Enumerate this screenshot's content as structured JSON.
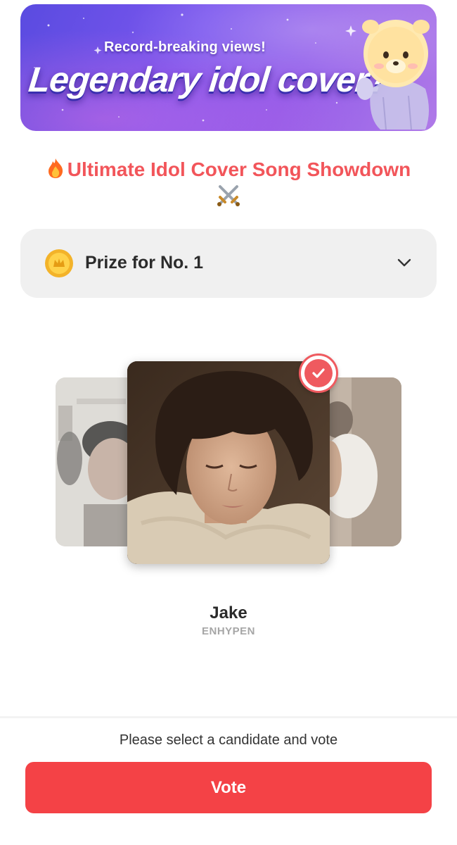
{
  "banner": {
    "subtitle": "Record-breaking views!",
    "title": "Legendary idol cover?"
  },
  "event": {
    "title": "Ultimate Idol Cover Song Showdown",
    "title_prefix_icon": "fire-emoji",
    "title_suffix_icon": "crossed-swords-emoji"
  },
  "prize": {
    "label": "Prize for No. 1",
    "icon": "gold-coin-icon",
    "expand_icon": "chevron-down-icon"
  },
  "candidate": {
    "name": "Jake",
    "group": "ENHYPEN",
    "selected": true
  },
  "footer": {
    "instruction": "Please select a candidate and vote",
    "vote_label": "Vote"
  },
  "colors": {
    "accent": "#f44246",
    "heading": "#f2555a",
    "prize_bg": "#f0f0f0"
  }
}
